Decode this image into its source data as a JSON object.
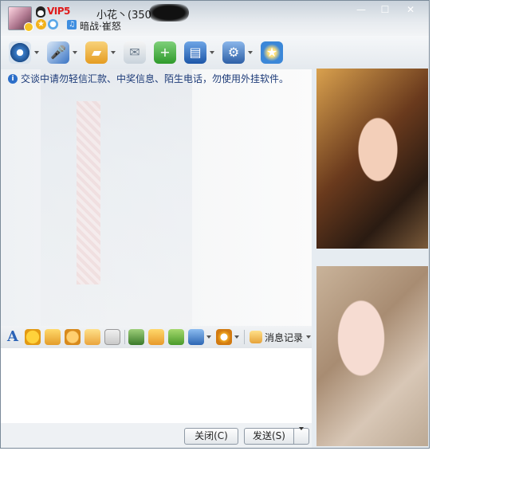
{
  "header": {
    "vip_label": "VIP5",
    "contact_name": "小花丶(350",
    "signature": "暗战·崔怒",
    "window_buttons": {
      "minimize": "—",
      "maximize": "☐",
      "close": "✕"
    }
  },
  "toolbar": {
    "icons": [
      "camera-icon",
      "microphone-icon",
      "folder-transfer-icon",
      "message-icon",
      "add-contact-icon",
      "applications-icon",
      "settings-icon",
      "qzone-icon"
    ]
  },
  "chat": {
    "notice": "交谈中请勿轻信汇款、中奖信息、陌生电话，勿使用外挂软件。"
  },
  "format_toolbar": {
    "font_label": "A",
    "message_history_label": "消息记录"
  },
  "input": {
    "value": ""
  },
  "buttons": {
    "close_label": "关闭(C)",
    "send_label": "发送(S)"
  },
  "colors": {
    "notice_text": "#1d3b78",
    "vip": "#e01a1a",
    "font_icon": "#2b63b6"
  }
}
